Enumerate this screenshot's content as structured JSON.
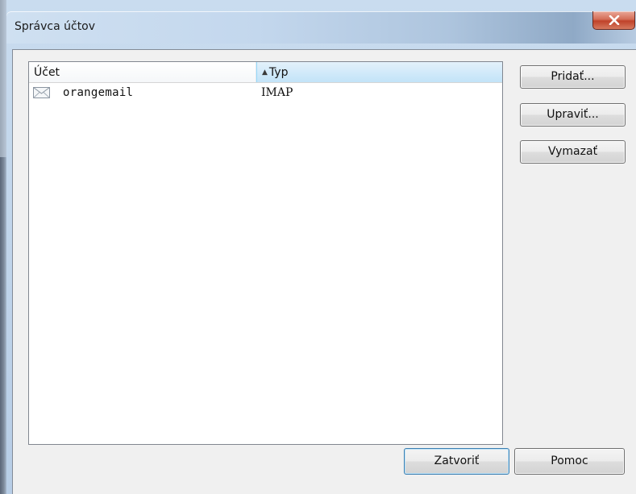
{
  "window": {
    "title": "Správca účtov",
    "close_glyph": "x"
  },
  "accounts_list": {
    "columns": [
      {
        "label": "Účet"
      },
      {
        "label": "Typ",
        "sorted": "ascending"
      }
    ],
    "rows": [
      {
        "name": "orangemail",
        "type": "IMAP",
        "icon": "envelope-icon"
      }
    ]
  },
  "buttons": {
    "add": "Pridať...",
    "edit": "Upraviť...",
    "delete": "Vymazať",
    "close": "Zatvoriť",
    "help": "Pomoc"
  },
  "colors": {
    "close_button": "#c0422a",
    "sorted_column_header": "#c2e3f8",
    "dialog_background": "#f0f0f0"
  }
}
